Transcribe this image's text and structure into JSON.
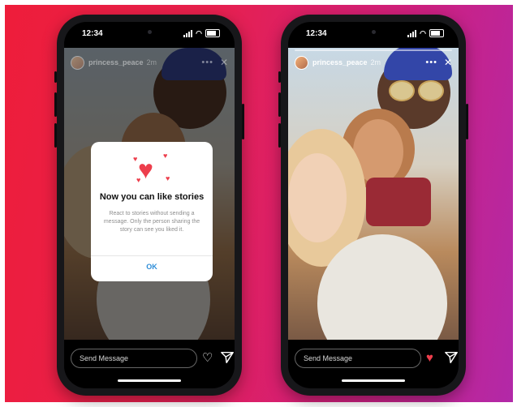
{
  "left_phone": {
    "status_time": "12:34",
    "story_user": "princess_peace",
    "story_age": "2m",
    "dialog": {
      "title": "Now you can like stories",
      "body": "React to stories without sending a message. Only the person sharing the story can see you liked it.",
      "ok_label": "OK"
    },
    "reply_placeholder": "Send Message",
    "like_state": "unliked"
  },
  "right_phone": {
    "status_time": "12:34",
    "story_user": "princess_peace",
    "story_age": "2m",
    "reply_placeholder": "Send Message",
    "like_state": "liked"
  },
  "colors": {
    "like_red": "#ed3e4c",
    "ok_blue": "#2d8dd8",
    "backdrop_start": "#ee1d3a",
    "backdrop_end": "#b229a8"
  },
  "icons": [
    "signal-icon",
    "wifi-icon",
    "battery-icon",
    "more-icon",
    "close-icon",
    "heart-icon",
    "send-icon"
  ]
}
